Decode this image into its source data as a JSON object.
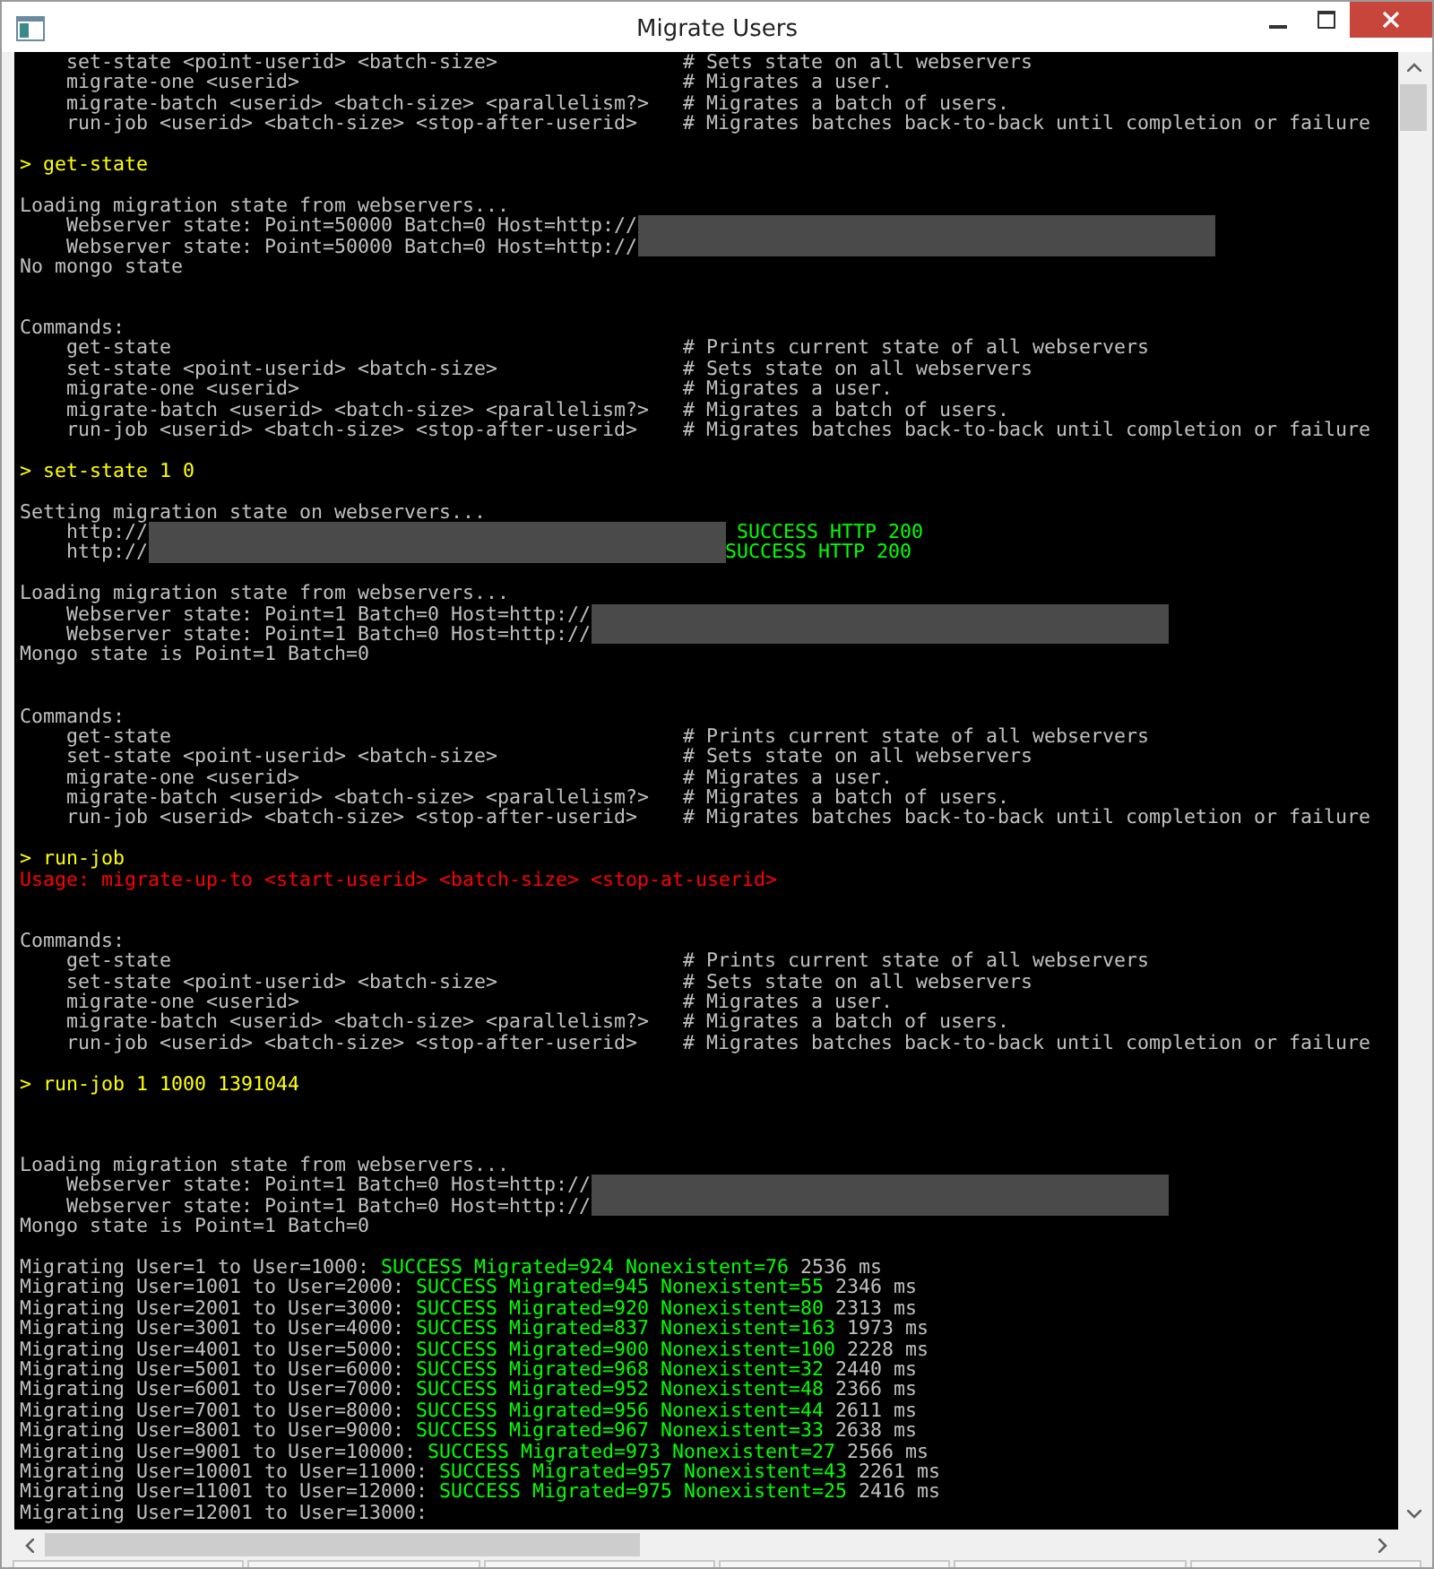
{
  "window": {
    "title": "Migrate Users"
  },
  "console": {
    "lines": [
      {
        "kind": "command",
        "command": "set-state <point-userid> <batch-size>",
        "description": "# Sets state on all webservers"
      },
      {
        "kind": "command",
        "command": "migrate-one <userid>",
        "description": "# Migrates a user."
      },
      {
        "kind": "command",
        "command": "migrate-batch <userid> <batch-size> <parallelism?>",
        "description": "# Migrates a batch of users."
      },
      {
        "kind": "command",
        "command": "run-job <userid> <batch-size> <stop-after-userid>",
        "description": "# Migrates batches back-to-back until completion or failure"
      },
      {
        "kind": "blank"
      },
      {
        "kind": "output",
        "indent": false,
        "segments": [
          {
            "kind": "prompt",
            "text": "> get-state"
          }
        ]
      },
      {
        "kind": "blank"
      },
      {
        "kind": "output",
        "indent": false,
        "segments": [
          {
            "kind": "plain",
            "text": "Loading migration state from webservers..."
          }
        ]
      },
      {
        "kind": "output",
        "indent": true,
        "segments": [
          {
            "kind": "plain",
            "text": "Webserver state: Point=50000 Batch=0 Host=http://"
          },
          {
            "kind": "redacted"
          }
        ]
      },
      {
        "kind": "output",
        "indent": true,
        "segments": [
          {
            "kind": "plain",
            "text": "Webserver state: Point=50000 Batch=0 Host=http://"
          },
          {
            "kind": "redacted"
          }
        ]
      },
      {
        "kind": "output",
        "indent": false,
        "segments": [
          {
            "kind": "plain",
            "text": "No mongo state"
          }
        ]
      },
      {
        "kind": "blank"
      },
      {
        "kind": "blank"
      },
      {
        "kind": "output",
        "indent": false,
        "segments": [
          {
            "kind": "plain",
            "text": "Commands:"
          }
        ]
      },
      {
        "kind": "command",
        "command": "get-state",
        "description": "# Prints current state of all webservers"
      },
      {
        "kind": "command",
        "command": "set-state <point-userid> <batch-size>",
        "description": "# Sets state on all webservers"
      },
      {
        "kind": "command",
        "command": "migrate-one <userid>",
        "description": "# Migrates a user."
      },
      {
        "kind": "command",
        "command": "migrate-batch <userid> <batch-size> <parallelism?>",
        "description": "# Migrates a batch of users."
      },
      {
        "kind": "command",
        "command": "run-job <userid> <batch-size> <stop-after-userid>",
        "description": "# Migrates batches back-to-back until completion or failure"
      },
      {
        "kind": "blank"
      },
      {
        "kind": "output",
        "indent": false,
        "segments": [
          {
            "kind": "prompt",
            "text": "> set-state 1 0"
          }
        ]
      },
      {
        "kind": "blank"
      },
      {
        "kind": "output",
        "indent": false,
        "segments": [
          {
            "kind": "plain",
            "text": "Setting migration state on webservers..."
          }
        ]
      },
      {
        "kind": "output",
        "indent": true,
        "segments": [
          {
            "kind": "plain",
            "text": "http://"
          },
          {
            "kind": "redacted"
          },
          {
            "kind": "success",
            "text": " SUCCESS HTTP 200"
          }
        ]
      },
      {
        "kind": "output",
        "indent": true,
        "segments": [
          {
            "kind": "plain",
            "text": "http://"
          },
          {
            "kind": "redacted"
          },
          {
            "kind": "success",
            "text": "SUCCESS HTTP 200"
          }
        ]
      },
      {
        "kind": "blank"
      },
      {
        "kind": "output",
        "indent": false,
        "segments": [
          {
            "kind": "plain",
            "text": "Loading migration state from webservers..."
          }
        ]
      },
      {
        "kind": "output",
        "indent": true,
        "segments": [
          {
            "kind": "plain",
            "text": "Webserver state: Point=1 Batch=0 Host=http://"
          },
          {
            "kind": "redacted"
          }
        ]
      },
      {
        "kind": "output",
        "indent": true,
        "segments": [
          {
            "kind": "plain",
            "text": "Webserver state: Point=1 Batch=0 Host=http://"
          },
          {
            "kind": "redacted"
          }
        ]
      },
      {
        "kind": "output",
        "indent": false,
        "segments": [
          {
            "kind": "plain",
            "text": "Mongo state is Point=1 Batch=0"
          }
        ]
      },
      {
        "kind": "blank"
      },
      {
        "kind": "blank"
      },
      {
        "kind": "output",
        "indent": false,
        "segments": [
          {
            "kind": "plain",
            "text": "Commands:"
          }
        ]
      },
      {
        "kind": "command",
        "command": "get-state",
        "description": "# Prints current state of all webservers"
      },
      {
        "kind": "command",
        "command": "set-state <point-userid> <batch-size>",
        "description": "# Sets state on all webservers"
      },
      {
        "kind": "command",
        "command": "migrate-one <userid>",
        "description": "# Migrates a user."
      },
      {
        "kind": "command",
        "command": "migrate-batch <userid> <batch-size> <parallelism?>",
        "description": "# Migrates a batch of users."
      },
      {
        "kind": "command",
        "command": "run-job <userid> <batch-size> <stop-after-userid>",
        "description": "# Migrates batches back-to-back until completion or failure"
      },
      {
        "kind": "blank"
      },
      {
        "kind": "output",
        "indent": false,
        "segments": [
          {
            "kind": "prompt",
            "text": "> run-job"
          }
        ]
      },
      {
        "kind": "output",
        "indent": false,
        "segments": [
          {
            "kind": "error",
            "text": "Usage: migrate-up-to <start-userid> <batch-size> <stop-at-userid>"
          }
        ]
      },
      {
        "kind": "blank"
      },
      {
        "kind": "blank"
      },
      {
        "kind": "output",
        "indent": false,
        "segments": [
          {
            "kind": "plain",
            "text": "Commands:"
          }
        ]
      },
      {
        "kind": "command",
        "command": "get-state",
        "description": "# Prints current state of all webservers"
      },
      {
        "kind": "command",
        "command": "set-state <point-userid> <batch-size>",
        "description": "# Sets state on all webservers"
      },
      {
        "kind": "command",
        "command": "migrate-one <userid>",
        "description": "# Migrates a user."
      },
      {
        "kind": "command",
        "command": "migrate-batch <userid> <batch-size> <parallelism?>",
        "description": "# Migrates a batch of users."
      },
      {
        "kind": "command",
        "command": "run-job <userid> <batch-size> <stop-after-userid>",
        "description": "# Migrates batches back-to-back until completion or failure"
      },
      {
        "kind": "blank"
      },
      {
        "kind": "output",
        "indent": false,
        "segments": [
          {
            "kind": "prompt",
            "text": "> run-job 1 1000 1391044"
          }
        ]
      },
      {
        "kind": "blank"
      },
      {
        "kind": "blank"
      },
      {
        "kind": "blank"
      },
      {
        "kind": "output",
        "indent": false,
        "segments": [
          {
            "kind": "plain",
            "text": "Loading migration state from webservers..."
          }
        ]
      },
      {
        "kind": "output",
        "indent": true,
        "segments": [
          {
            "kind": "plain",
            "text": "Webserver state: Point=1 Batch=0 Host=http://"
          },
          {
            "kind": "redacted"
          }
        ]
      },
      {
        "kind": "output",
        "indent": true,
        "segments": [
          {
            "kind": "plain",
            "text": "Webserver state: Point=1 Batch=0 Host=http://"
          },
          {
            "kind": "redacted"
          }
        ]
      },
      {
        "kind": "output",
        "indent": false,
        "segments": [
          {
            "kind": "plain",
            "text": "Mongo state is Point=1 Batch=0"
          }
        ]
      },
      {
        "kind": "blank"
      },
      {
        "kind": "output",
        "indent": false,
        "segments": [
          {
            "kind": "plain",
            "text": "Migrating User=1 to User=1000: "
          },
          {
            "kind": "success",
            "text": "SUCCESS Migrated=924 Nonexistent=76"
          },
          {
            "kind": "plain",
            "text": " 2536 ms"
          }
        ]
      },
      {
        "kind": "output",
        "indent": false,
        "segments": [
          {
            "kind": "plain",
            "text": "Migrating User=1001 to User=2000: "
          },
          {
            "kind": "success",
            "text": "SUCCESS Migrated=945 Nonexistent=55"
          },
          {
            "kind": "plain",
            "text": " 2346 ms"
          }
        ]
      },
      {
        "kind": "output",
        "indent": false,
        "segments": [
          {
            "kind": "plain",
            "text": "Migrating User=2001 to User=3000: "
          },
          {
            "kind": "success",
            "text": "SUCCESS Migrated=920 Nonexistent=80"
          },
          {
            "kind": "plain",
            "text": " 2313 ms"
          }
        ]
      },
      {
        "kind": "output",
        "indent": false,
        "segments": [
          {
            "kind": "plain",
            "text": "Migrating User=3001 to User=4000: "
          },
          {
            "kind": "success",
            "text": "SUCCESS Migrated=837 Nonexistent=163"
          },
          {
            "kind": "plain",
            "text": " 1973 ms"
          }
        ]
      },
      {
        "kind": "output",
        "indent": false,
        "segments": [
          {
            "kind": "plain",
            "text": "Migrating User=4001 to User=5000: "
          },
          {
            "kind": "success",
            "text": "SUCCESS Migrated=900 Nonexistent=100"
          },
          {
            "kind": "plain",
            "text": " 2228 ms"
          }
        ]
      },
      {
        "kind": "output",
        "indent": false,
        "segments": [
          {
            "kind": "plain",
            "text": "Migrating User=5001 to User=6000: "
          },
          {
            "kind": "success",
            "text": "SUCCESS Migrated=968 Nonexistent=32"
          },
          {
            "kind": "plain",
            "text": " 2440 ms"
          }
        ]
      },
      {
        "kind": "output",
        "indent": false,
        "segments": [
          {
            "kind": "plain",
            "text": "Migrating User=6001 to User=7000: "
          },
          {
            "kind": "success",
            "text": "SUCCESS Migrated=952 Nonexistent=48"
          },
          {
            "kind": "plain",
            "text": " 2366 ms"
          }
        ]
      },
      {
        "kind": "output",
        "indent": false,
        "segments": [
          {
            "kind": "plain",
            "text": "Migrating User=7001 to User=8000: "
          },
          {
            "kind": "success",
            "text": "SUCCESS Migrated=956 Nonexistent=44"
          },
          {
            "kind": "plain",
            "text": " 2611 ms"
          }
        ]
      },
      {
        "kind": "output",
        "indent": false,
        "segments": [
          {
            "kind": "plain",
            "text": "Migrating User=8001 to User=9000: "
          },
          {
            "kind": "success",
            "text": "SUCCESS Migrated=967 Nonexistent=33"
          },
          {
            "kind": "plain",
            "text": " 2638 ms"
          }
        ]
      },
      {
        "kind": "output",
        "indent": false,
        "segments": [
          {
            "kind": "plain",
            "text": "Migrating User=9001 to User=10000: "
          },
          {
            "kind": "success",
            "text": "SUCCESS Migrated=973 Nonexistent=27"
          },
          {
            "kind": "plain",
            "text": " 2566 ms"
          }
        ]
      },
      {
        "kind": "output",
        "indent": false,
        "segments": [
          {
            "kind": "plain",
            "text": "Migrating User=10001 to User=11000: "
          },
          {
            "kind": "success",
            "text": "SUCCESS Migrated=957 Nonexistent=43"
          },
          {
            "kind": "plain",
            "text": " 2261 ms"
          }
        ]
      },
      {
        "kind": "output",
        "indent": false,
        "segments": [
          {
            "kind": "plain",
            "text": "Migrating User=11001 to User=12000: "
          },
          {
            "kind": "success",
            "text": "SUCCESS Migrated=975 Nonexistent=25"
          },
          {
            "kind": "plain",
            "text": " 2416 ms"
          }
        ]
      },
      {
        "kind": "output",
        "indent": false,
        "segments": [
          {
            "kind": "plain",
            "text": "Migrating User=12001 to User=13000:"
          }
        ]
      }
    ]
  }
}
